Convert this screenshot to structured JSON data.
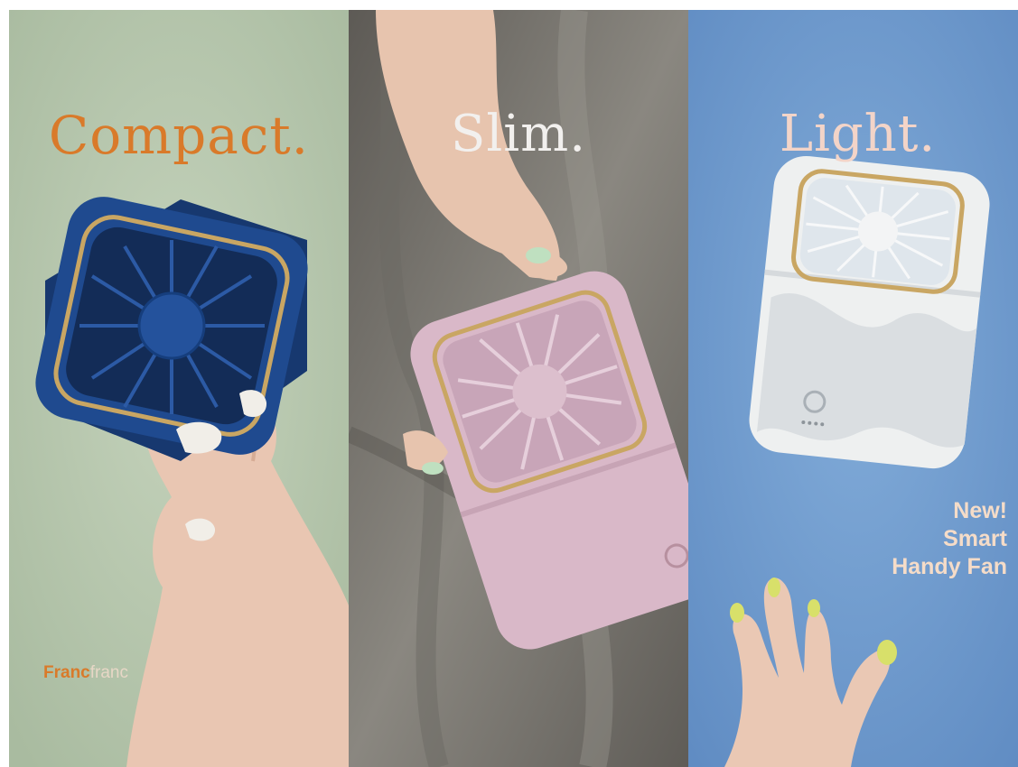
{
  "panels": [
    {
      "headline": "Compact.",
      "theme_color": "#b9c9b0",
      "product_color": "#1f4a8f"
    },
    {
      "headline": "Slim.",
      "theme_color": "#7d7a74",
      "product_color": "#d9b8c8"
    },
    {
      "headline": "Light.",
      "theme_color": "#6f9bcf",
      "product_color": "#eef0f0"
    }
  ],
  "brand": {
    "bold": "Franc",
    "light": "franc"
  },
  "tagline": [
    "New!",
    "Smart",
    "Handy Fan"
  ]
}
